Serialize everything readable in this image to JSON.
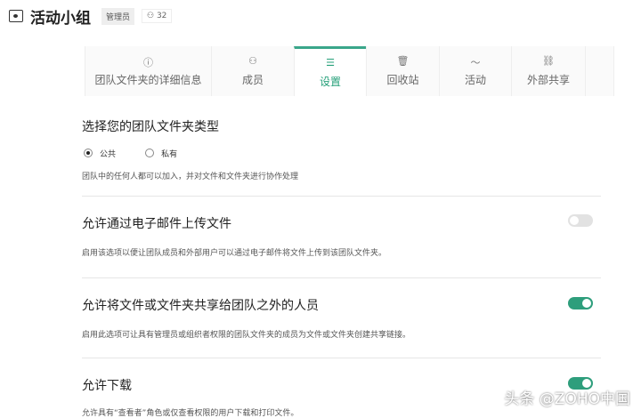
{
  "header": {
    "title": "活动小组",
    "role_badge": "管理员",
    "member_count": "32"
  },
  "tabs": [
    {
      "label": "团队文件夹的详细信息",
      "icon": "info-icon"
    },
    {
      "label": "成员",
      "icon": "members-icon"
    },
    {
      "label": "设置",
      "icon": "settings-sliders-icon",
      "active": true
    },
    {
      "label": "回收站",
      "icon": "trash-icon"
    },
    {
      "label": "活动",
      "icon": "activity-icon"
    },
    {
      "label": "外部共享",
      "icon": "link-icon"
    }
  ],
  "type_section": {
    "title": "选择您的团队文件夹类型",
    "options": [
      "公共",
      "私有"
    ],
    "selected": "公共",
    "description": "团队中的任何人都可以加入，并对文件和文件夹进行协作处理"
  },
  "settings": [
    {
      "title": "允许通过电子邮件上传文件",
      "description": "启用该选项以便让团队成员和外部用户可以通过电子邮件将文件上传到该团队文件夹。",
      "enabled": false
    },
    {
      "title": "允许将文件或文件夹共享给团队之外的人员",
      "description": "启用此选项可让具有管理员或组织者权限的团队文件夹的成员为文件或文件夹创建共享链接。",
      "enabled": true
    },
    {
      "title": "允许下载",
      "description": "允许具有“查看者”角色或仅查看权限的用户下载和打印文件。",
      "enabled": true
    }
  ],
  "watermark": "头条 @ZOHO中国"
}
